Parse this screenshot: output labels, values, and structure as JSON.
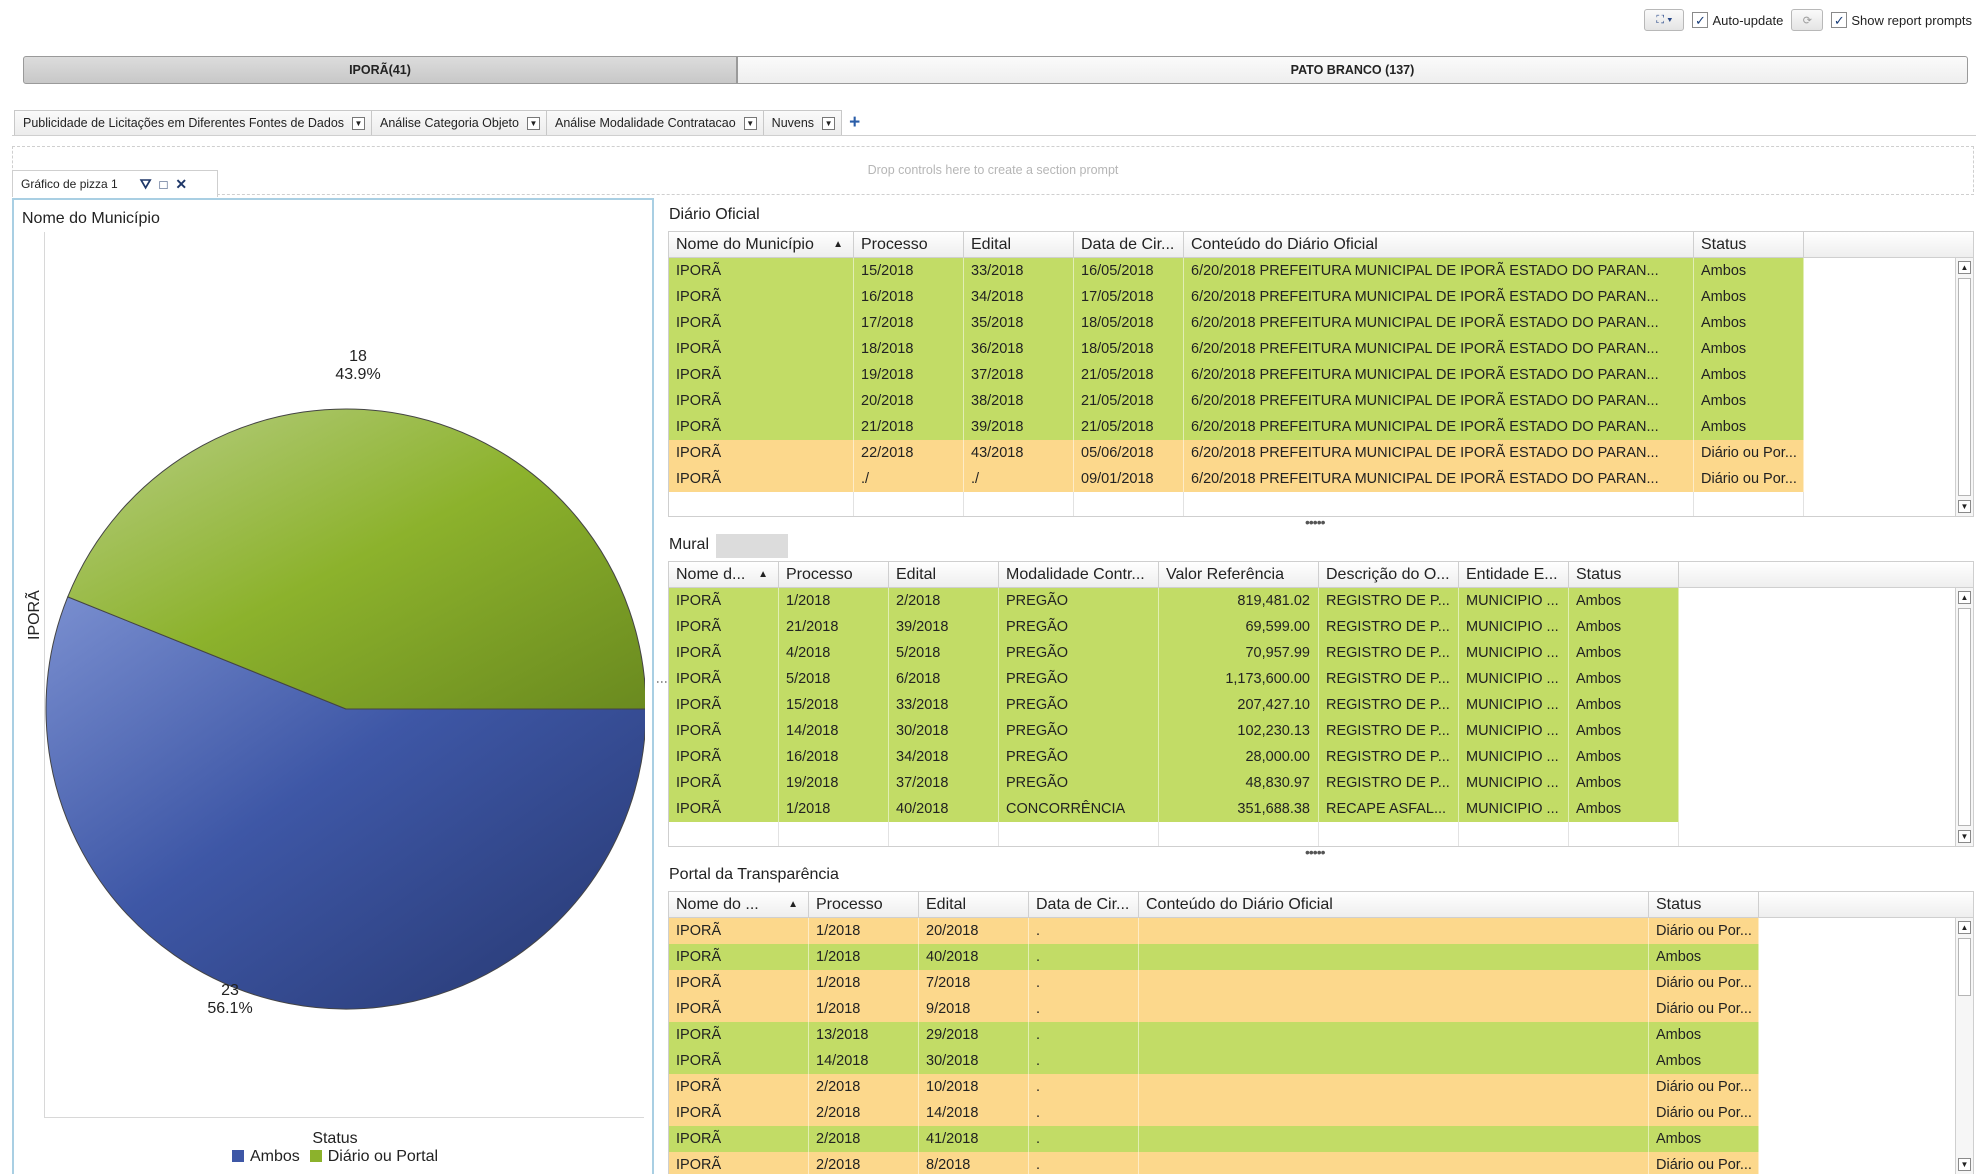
{
  "toolbar": {
    "layout_icon": "fullscreen-icon",
    "auto_update_label": "Auto-update",
    "auto_update_checked": true,
    "refresh_icon": "refresh-icon",
    "show_prompts_label": "Show report prompts",
    "show_prompts_checked": true
  },
  "municipality_tabs": [
    {
      "label": "IPORÃ(41)",
      "active": true
    },
    {
      "label": "PATO BRANCO (137)",
      "active": false
    }
  ],
  "report_tabs": [
    {
      "label": "Publicidade de Licitações em Diferentes Fontes de Dados"
    },
    {
      "label": "Análise Categoria Objeto"
    },
    {
      "label": "Análise Modalidade Contratacao"
    },
    {
      "label": "Nuvens"
    }
  ],
  "dropzone_text": "Drop controls here to create a section prompt",
  "pie_panel": {
    "tab_label": "Gráfico de pizza 1",
    "title": "Nome do Município",
    "axis_label": "IPORÃ",
    "legend_title": "Status",
    "labels": [
      {
        "count": "18",
        "pct": "43.9%"
      },
      {
        "count": "23",
        "pct": "56.1%"
      }
    ]
  },
  "chart_data": {
    "type": "pie",
    "title": "Nome do Município",
    "category_label": "IPORÃ",
    "legend_title": "Status",
    "legend_placement": "bottom",
    "series": [
      {
        "name": "Ambos",
        "value": 23,
        "percent": 56.1,
        "color": "#3e57a6"
      },
      {
        "name": "Diário ou Portal",
        "value": 18,
        "percent": 43.9,
        "color": "#8cb22c"
      }
    ]
  },
  "colors": {
    "green_row": "#c2dc66",
    "amber_row": "#fcd88c",
    "panel_border": "#a9cfe3"
  },
  "diario": {
    "title": "Diário Oficial",
    "columns": [
      "Nome do Município",
      "Processo",
      "Edital",
      "Data de Cir...",
      "Conteúdo do Diário Oficial",
      "Status"
    ],
    "rows": [
      {
        "s": "green",
        "c": [
          "IPORÃ",
          "15/2018",
          "33/2018",
          "16/05/2018",
          "6/20/2018 PREFEITURA MUNICIPAL DE IPORÃ ESTADO DO PARAN...",
          "Ambos"
        ]
      },
      {
        "s": "green",
        "c": [
          "IPORÃ",
          "16/2018",
          "34/2018",
          "17/05/2018",
          "6/20/2018 PREFEITURA MUNICIPAL DE IPORÃ ESTADO DO PARAN...",
          "Ambos"
        ]
      },
      {
        "s": "green",
        "c": [
          "IPORÃ",
          "17/2018",
          "35/2018",
          "18/05/2018",
          "6/20/2018 PREFEITURA MUNICIPAL DE IPORÃ ESTADO DO PARAN...",
          "Ambos"
        ]
      },
      {
        "s": "green",
        "c": [
          "IPORÃ",
          "18/2018",
          "36/2018",
          "18/05/2018",
          "6/20/2018 PREFEITURA MUNICIPAL DE IPORÃ ESTADO DO PARAN...",
          "Ambos"
        ]
      },
      {
        "s": "green",
        "c": [
          "IPORÃ",
          "19/2018",
          "37/2018",
          "21/05/2018",
          "6/20/2018 PREFEITURA MUNICIPAL DE IPORÃ ESTADO DO PARAN...",
          "Ambos"
        ]
      },
      {
        "s": "green",
        "c": [
          "IPORÃ",
          "20/2018",
          "38/2018",
          "21/05/2018",
          "6/20/2018 PREFEITURA MUNICIPAL DE IPORÃ ESTADO DO PARAN...",
          "Ambos"
        ]
      },
      {
        "s": "green",
        "c": [
          "IPORÃ",
          "21/2018",
          "39/2018",
          "21/05/2018",
          "6/20/2018 PREFEITURA MUNICIPAL DE IPORÃ ESTADO DO PARAN...",
          "Ambos"
        ]
      },
      {
        "s": "amber",
        "c": [
          "IPORÃ",
          "22/2018",
          "43/2018",
          "05/06/2018",
          "6/20/2018 PREFEITURA MUNICIPAL DE IPORÃ ESTADO DO PARAN...",
          "Diário ou Por..."
        ]
      },
      {
        "s": "amber",
        "c": [
          "IPORÃ",
          "./",
          "./",
          "09/01/2018",
          "6/20/2018 PREFEITURA MUNICIPAL DE IPORÃ ESTADO DO PARAN...",
          "Diário ou Por..."
        ]
      }
    ]
  },
  "mural": {
    "title": "Mural",
    "columns": [
      "Nome d...",
      "Processo",
      "Edital",
      "Modalidade Contr...",
      "Valor Referência",
      "Descrição do O...",
      "Entidade E...",
      "Status"
    ],
    "rows": [
      {
        "s": "green",
        "c": [
          "IPORÃ",
          "1/2018",
          "2/2018",
          "PREGÃO",
          "819,481.02",
          "REGISTRO DE P...",
          "MUNICIPIO ...",
          "Ambos"
        ]
      },
      {
        "s": "green",
        "c": [
          "IPORÃ",
          "21/2018",
          "39/2018",
          "PREGÃO",
          "69,599.00",
          "REGISTRO DE P...",
          "MUNICIPIO ...",
          "Ambos"
        ]
      },
      {
        "s": "green",
        "c": [
          "IPORÃ",
          "4/2018",
          "5/2018",
          "PREGÃO",
          "70,957.99",
          "REGISTRO DE P...",
          "MUNICIPIO ...",
          "Ambos"
        ]
      },
      {
        "s": "green",
        "c": [
          "IPORÃ",
          "5/2018",
          "6/2018",
          "PREGÃO",
          "1,173,600.00",
          "REGISTRO DE P...",
          "MUNICIPIO ...",
          "Ambos"
        ]
      },
      {
        "s": "green",
        "c": [
          "IPORÃ",
          "15/2018",
          "33/2018",
          "PREGÃO",
          "207,427.10",
          "REGISTRO DE P...",
          "MUNICIPIO ...",
          "Ambos"
        ]
      },
      {
        "s": "green",
        "c": [
          "IPORÃ",
          "14/2018",
          "30/2018",
          "PREGÃO",
          "102,230.13",
          "REGISTRO DE P...",
          "MUNICIPIO ...",
          "Ambos"
        ]
      },
      {
        "s": "green",
        "c": [
          "IPORÃ",
          "16/2018",
          "34/2018",
          "PREGÃO",
          "28,000.00",
          "REGISTRO DE P...",
          "MUNICIPIO ...",
          "Ambos"
        ]
      },
      {
        "s": "green",
        "c": [
          "IPORÃ",
          "19/2018",
          "37/2018",
          "PREGÃO",
          "48,830.97",
          "REGISTRO DE P...",
          "MUNICIPIO ...",
          "Ambos"
        ]
      },
      {
        "s": "green",
        "c": [
          "IPORÃ",
          "1/2018",
          "40/2018",
          "CONCORRÊNCIA",
          "351,688.38",
          "RECAPE ASFAL...",
          "MUNICIPIO ...",
          "Ambos"
        ]
      }
    ]
  },
  "portal": {
    "title": "Portal da Transparência",
    "columns": [
      "Nome do ...",
      "Processo",
      "Edital",
      "Data de Cir...",
      "Conteúdo do Diário Oficial",
      "Status"
    ],
    "rows": [
      {
        "s": "amber",
        "c": [
          "IPORÃ",
          "1/2018",
          "20/2018",
          ".",
          "",
          "Diário ou Por..."
        ]
      },
      {
        "s": "green",
        "c": [
          "IPORÃ",
          "1/2018",
          "40/2018",
          ".",
          "",
          "Ambos"
        ]
      },
      {
        "s": "amber",
        "c": [
          "IPORÃ",
          "1/2018",
          "7/2018",
          ".",
          "",
          "Diário ou Por..."
        ]
      },
      {
        "s": "amber",
        "c": [
          "IPORÃ",
          "1/2018",
          "9/2018",
          ".",
          "",
          "Diário ou Por..."
        ]
      },
      {
        "s": "green",
        "c": [
          "IPORÃ",
          "13/2018",
          "29/2018",
          ".",
          "",
          "Ambos"
        ]
      },
      {
        "s": "green",
        "c": [
          "IPORÃ",
          "14/2018",
          "30/2018",
          ".",
          "",
          "Ambos"
        ]
      },
      {
        "s": "amber",
        "c": [
          "IPORÃ",
          "2/2018",
          "10/2018",
          ".",
          "",
          "Diário ou Por..."
        ]
      },
      {
        "s": "amber",
        "c": [
          "IPORÃ",
          "2/2018",
          "14/2018",
          ".",
          "",
          "Diário ou Por..."
        ]
      },
      {
        "s": "green",
        "c": [
          "IPORÃ",
          "2/2018",
          "41/2018",
          ".",
          "",
          "Ambos"
        ]
      },
      {
        "s": "amber",
        "c": [
          "IPORÃ",
          "2/2018",
          "8/2018",
          ".",
          "",
          "Diário ou Por..."
        ]
      }
    ]
  }
}
